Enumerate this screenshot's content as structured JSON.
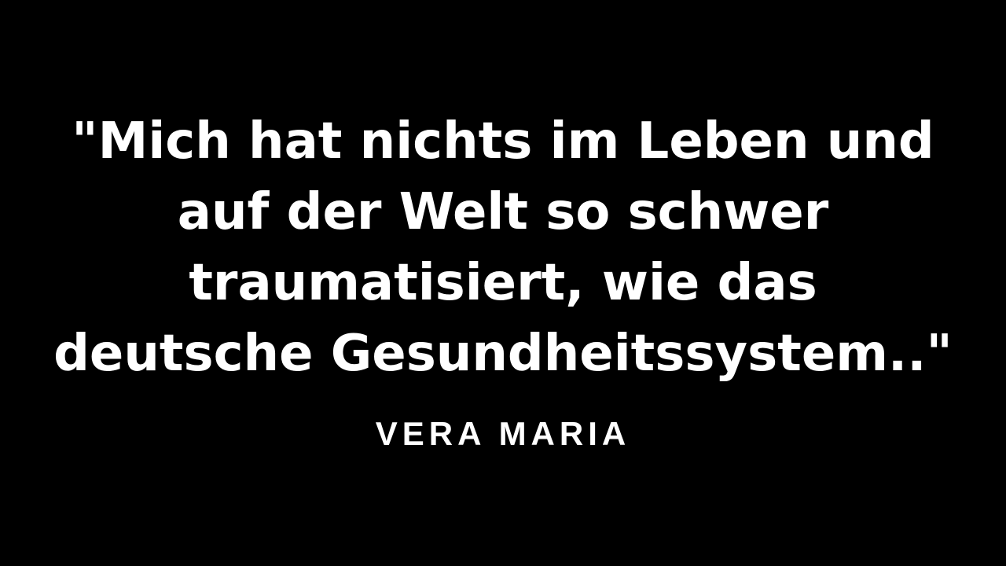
{
  "quote": {
    "lines": [
      "\"Mich hat nichts im Leben und",
      "auf der Welt so schwer",
      "traumatisiert, wie das",
      "deutsche Gesundheitssystem..\""
    ]
  },
  "author": "VERA MARIA",
  "colors": {
    "background": "#000000",
    "text": "#ffffff"
  }
}
